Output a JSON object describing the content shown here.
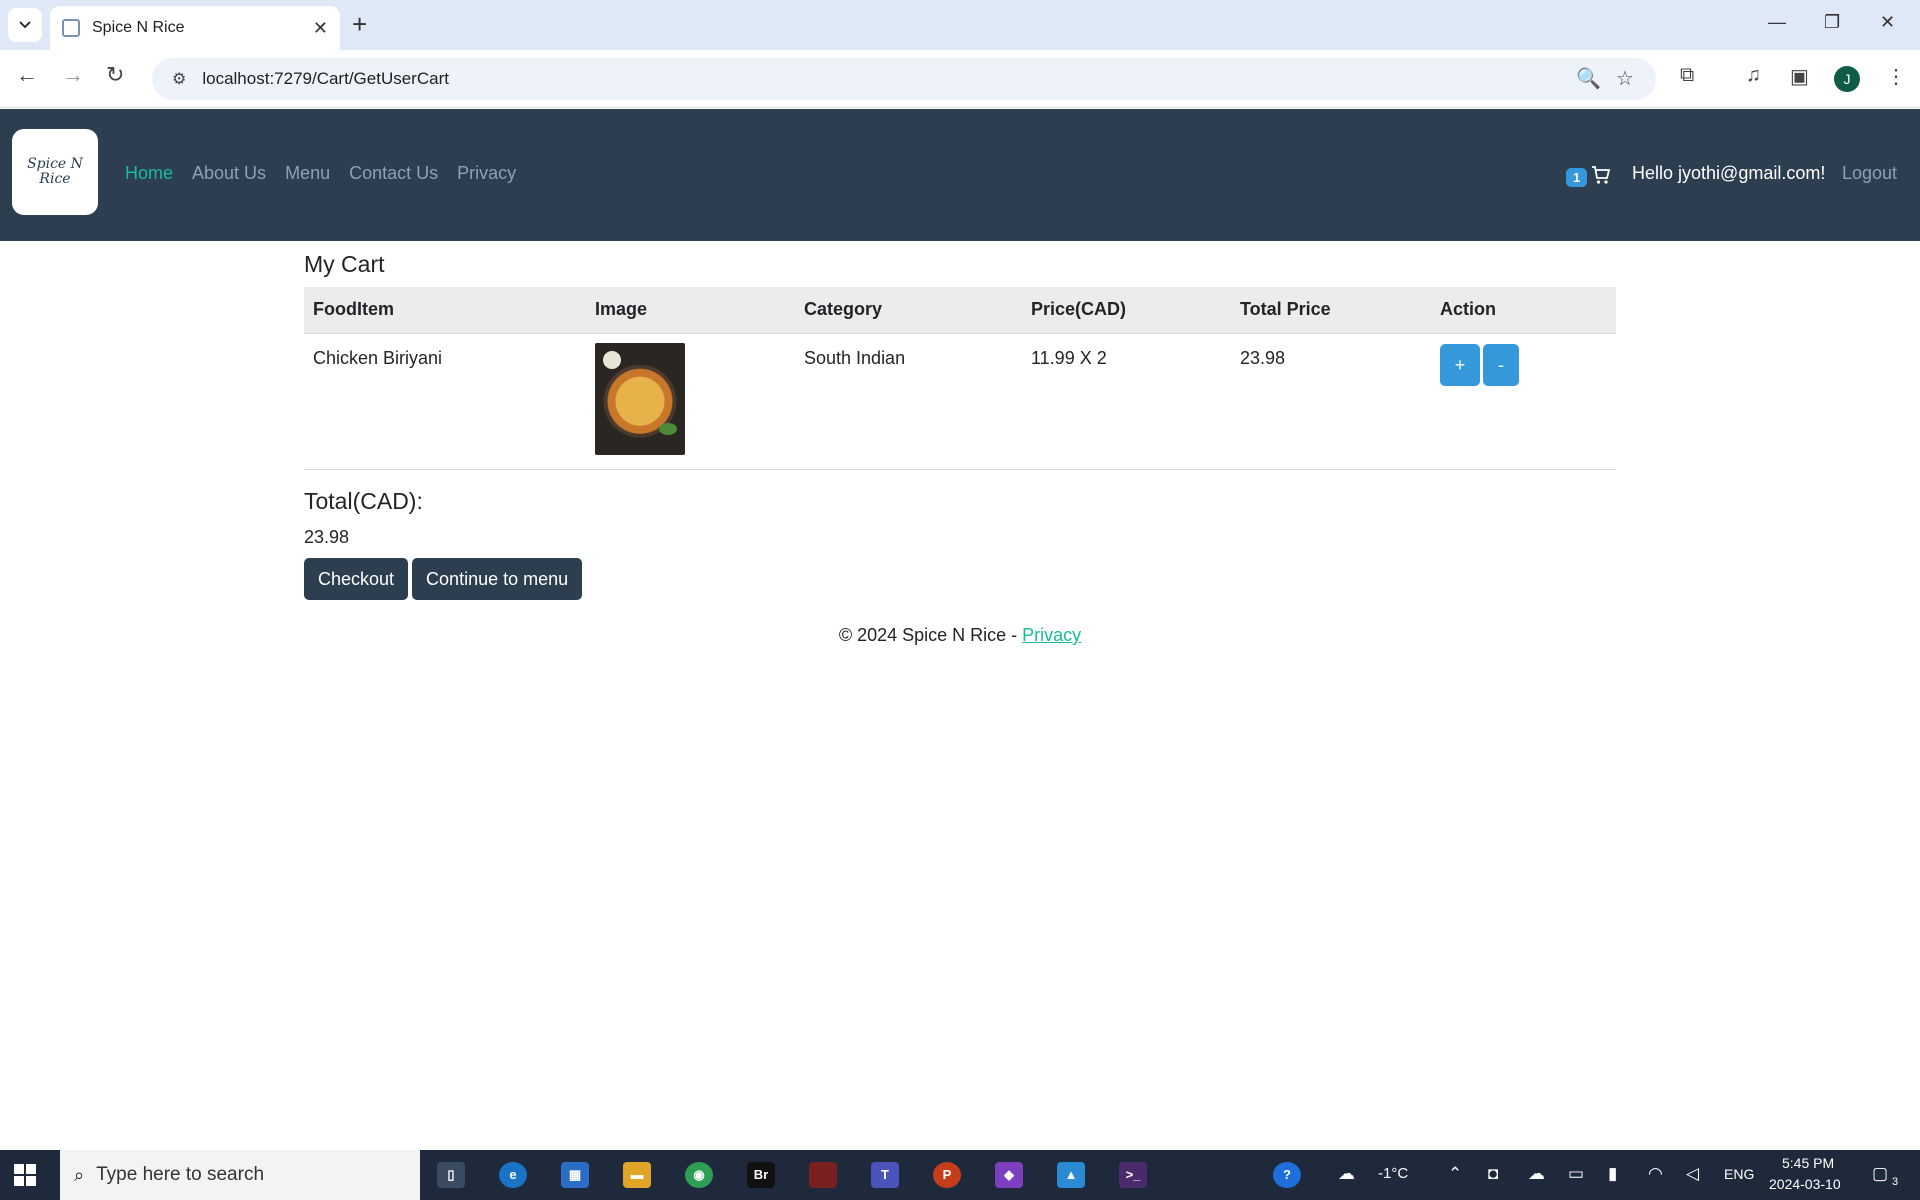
{
  "browser": {
    "tab_title": "Spice N Rice",
    "url": "localhost:7279/Cart/GetUserCart",
    "profile_initial": "J",
    "icons": [
      "tab-list-icon",
      "favicon-icon",
      "close-tab-icon",
      "new-tab-icon",
      "minimize-icon",
      "restore-icon",
      "close-window-icon",
      "back-icon",
      "forward-icon",
      "reload-icon",
      "site-info-icon",
      "zoom-icon",
      "bookmark-star-icon",
      "extensions-icon",
      "media-icon",
      "side-panel-icon",
      "more-icon"
    ]
  },
  "site": {
    "logo_text": "Spice N Rice",
    "nav": [
      "Home",
      "About Us",
      "Menu",
      "Contact Us",
      "Privacy"
    ],
    "active_nav": "Home",
    "cart_count": "1",
    "greeting": "Hello jyothi@gmail.com!",
    "logout": "Logout"
  },
  "cart": {
    "title": "My Cart",
    "columns": [
      "FoodItem",
      "Image",
      "Category",
      "Price(CAD)",
      "Total Price",
      "Action"
    ],
    "rows": [
      {
        "food_item": "Chicken Biriyani",
        "category": "South Indian",
        "price": "11.99 X 2",
        "total": "23.98",
        "plus_label": "+",
        "minus_label": "-"
      }
    ],
    "total_label": "Total(CAD):",
    "total_value": "23.98",
    "checkout_label": "Checkout",
    "continue_label": "Continue to menu"
  },
  "footer": {
    "text": "© 2024 Spice N Rice - ",
    "privacy_link": "Privacy"
  },
  "taskbar": {
    "search_placeholder": "Type here to search",
    "temperature": "-1°C",
    "language": "ENG",
    "time": "5:45 PM",
    "date": "2024-03-10",
    "notification_count": "3",
    "apps": [
      "Br"
    ]
  },
  "colors": {
    "navbar": "#2c3e50",
    "accent_green": "#18bc9c",
    "button_blue": "#3498db"
  }
}
